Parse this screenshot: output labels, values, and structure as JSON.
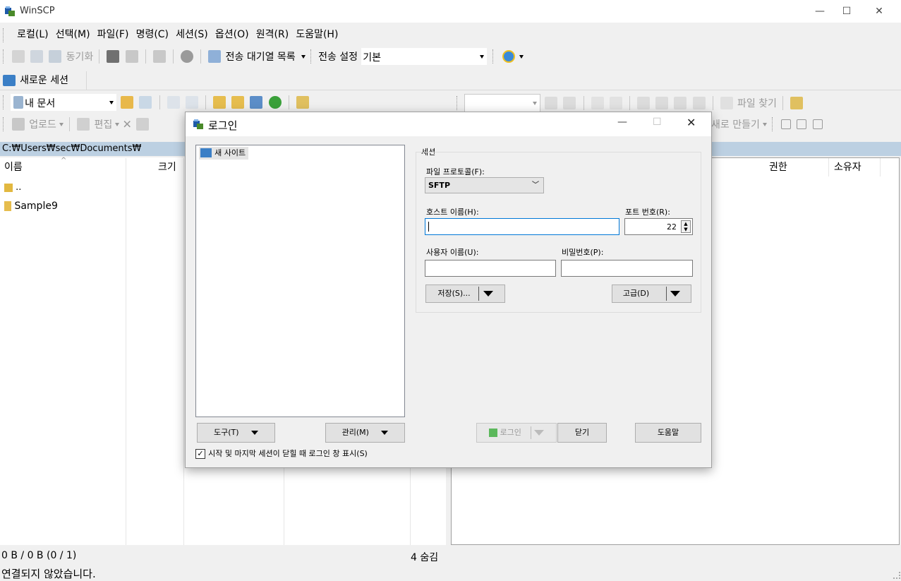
{
  "window": {
    "title": "WinSCP",
    "controls": [
      "—",
      "☐",
      "✕"
    ]
  },
  "menu": [
    "로컬(L)",
    "선택(M)",
    "파일(F)",
    "명령(C)",
    "세션(S)",
    "옵션(O)",
    "원격(R)",
    "도움말(H)"
  ],
  "toolbar1": {
    "sync_label": "동기화",
    "queue_label": "전송 대기열 목록",
    "transfer_settings_label": "전송 설정",
    "transfer_preset": "기본"
  },
  "session_tab": {
    "label": "새로운 세션"
  },
  "local": {
    "location": "내 문서",
    "upload_label": "업로드",
    "edit_label": "편집",
    "path": "C:₩Users₩sec₩Documents₩",
    "columns": [
      "이름",
      "크기"
    ],
    "files": [
      {
        "name": ".."
      },
      {
        "name": "Sample9"
      }
    ],
    "status_bytes": "0 B / 0 B (0 / 1)",
    "status_hidden": "4 숨김"
  },
  "remote": {
    "find_files_label": "파일 찾기",
    "new_label": "새로 만들기",
    "columns": [
      "권한",
      "소유자"
    ]
  },
  "status_bar": {
    "connection": "연결되지 않았습니다."
  },
  "login": {
    "title": "로그인",
    "site_tree": [
      {
        "label": "새 사이트"
      }
    ],
    "tools_label": "도구(T)",
    "manage_label": "관리(M)",
    "show_login_checkbox": "시작 및 마지막 세션이 닫힐 때 로그인 창 표시(S)",
    "show_login_checked": true,
    "session_group_label": "세션",
    "protocol_label": "파일 프로토콜(F):",
    "protocol_value": "SFTP",
    "host_label": "호스트 이름(H):",
    "host_value": "",
    "port_label": "포트 번호(R):",
    "port_value": "22",
    "user_label": "사용자 이름(U):",
    "user_value": "",
    "password_label": "비밀번호(P):",
    "password_value": "",
    "save_label": "저장(S)...",
    "advanced_label": "고급(D)",
    "login_label": "로그인",
    "close_label": "닫기",
    "help_label": "도움말"
  }
}
